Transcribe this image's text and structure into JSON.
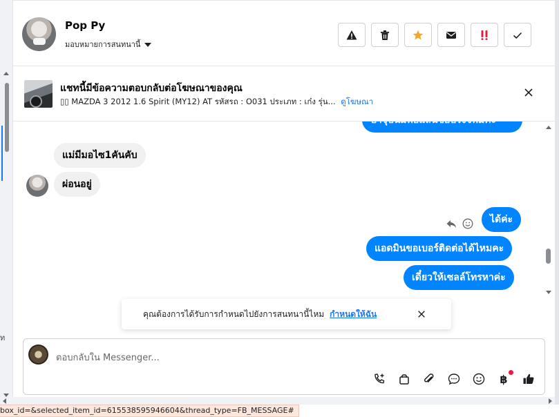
{
  "header": {
    "user_name": "Pop Py",
    "assign_label": "มอบหมายการสนทนานี้",
    "actions": [
      {
        "name": "report-button",
        "icon": "warning-icon",
        "color": "#1c1e21"
      },
      {
        "name": "delete-button",
        "icon": "trash-icon",
        "color": "#1c1e21"
      },
      {
        "name": "star-button",
        "icon": "star-icon",
        "color": "#f5a623"
      },
      {
        "name": "mark-unread-button",
        "icon": "envelope-icon",
        "color": "#1c1e21"
      },
      {
        "name": "follow-up-button",
        "icon": "double-exclamation-icon",
        "color": "#e41e3f"
      },
      {
        "name": "done-button",
        "icon": "check-icon",
        "color": "#1c1e21"
      }
    ]
  },
  "ad_banner": {
    "title": "แชทนี้มีข้อความตอบกลับต่อโฆษณาของคุณ",
    "subtitle": "▯▯ MAZDA 3 2012 1.6 Spirit (MY12) AT รหัสรถ : O031 ประเภท : เก๋ง รุ่น...",
    "link": "ดูโฆษณา"
  },
  "messages": [
    {
      "direction": "out",
      "text": "ปาจุบนมพอแลนขอบรงจพมคะ",
      "partial": true
    },
    {
      "direction": "in",
      "text": "แม่มีมอไซ1คันคับ"
    },
    {
      "direction": "in",
      "text": "ผ่อนอยู่"
    },
    {
      "direction": "out",
      "text": "ได้ค่ะ"
    },
    {
      "direction": "out",
      "text": "แอดมินขอเบอร์ติดต่อได้ไหมคะ"
    },
    {
      "direction": "out",
      "text": "เดี๋ยวให้เซลล์โทรหาค่ะ"
    }
  ],
  "toast": {
    "text": "คุณต้องการได้รับการกำหนดไปยังการสนทนานี้ไหม",
    "link": "กำหนดให้ฉัน"
  },
  "composer": {
    "placeholder": "ตอบกลับใน Messenger...",
    "tools": [
      "phone-plus-icon",
      "shopping-bag-icon",
      "paperclip-icon",
      "chat-bubble-icon",
      "emoji-icon",
      "baht-icon",
      "thumbs-up-icon"
    ],
    "baht_symbol": "฿"
  },
  "status_bar": {
    "url_fragment": "box_id=&selected_item_id=615538595946604&thread_type=FB_MESSAGE#"
  },
  "left_strip": {
    "cut_text": "ท"
  },
  "colors": {
    "messenger_blue": "#0084ff",
    "incoming_gray": "#f0f0f0",
    "link_blue": "#1877f2",
    "badge_red": "#e41e3f"
  }
}
